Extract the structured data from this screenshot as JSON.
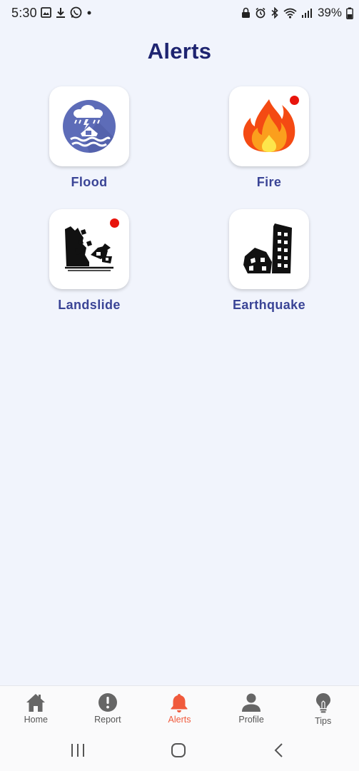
{
  "status_bar": {
    "time": "5:30",
    "battery": "39%",
    "left_icons": [
      "image-icon",
      "download-icon",
      "whatsapp-icon",
      "dot-icon"
    ],
    "right_icons": [
      "lock-icon",
      "alarm-icon",
      "bluetooth-icon",
      "wifi-icon",
      "signal-icon",
      "battery-icon"
    ]
  },
  "page": {
    "title": "Alerts"
  },
  "alerts": [
    {
      "label": "Flood",
      "icon": "flood-icon",
      "has_notification": false
    },
    {
      "label": "Fire",
      "icon": "fire-icon",
      "has_notification": true
    },
    {
      "label": "Landslide",
      "icon": "landslide-icon",
      "has_notification": true
    },
    {
      "label": "Earthquake",
      "icon": "earthquake-icon",
      "has_notification": false
    }
  ],
  "bottom_nav": {
    "items": [
      {
        "label": "Home",
        "icon": "home-icon",
        "active": false
      },
      {
        "label": "Report",
        "icon": "report-icon",
        "active": false
      },
      {
        "label": "Alerts",
        "icon": "bell-icon",
        "active": true
      },
      {
        "label": "Profile",
        "icon": "person-icon",
        "active": false
      },
      {
        "label": "Tips",
        "icon": "lightbulb-icon",
        "active": false
      }
    ]
  },
  "system_nav": {
    "buttons": [
      "recent-apps-icon",
      "home-circle-icon",
      "back-icon"
    ]
  },
  "colors": {
    "background": "#F1F4FC",
    "title": "#1E2470",
    "label": "#3A4496",
    "active_nav": "#F05A3C",
    "notification": "#E8140C"
  }
}
